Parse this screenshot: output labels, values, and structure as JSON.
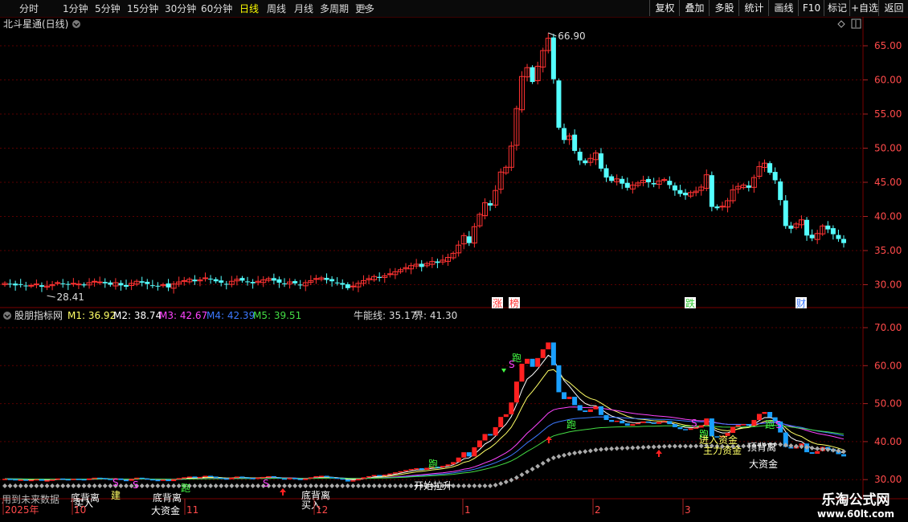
{
  "periods": [
    {
      "label": "分时",
      "active": false
    },
    {
      "label": "1分钟",
      "active": false
    },
    {
      "label": "5分钟",
      "active": false
    },
    {
      "label": "15分钟",
      "active": false
    },
    {
      "label": "30分钟",
      "active": false
    },
    {
      "label": "60分钟",
      "active": false
    },
    {
      "label": "日线",
      "active": true
    },
    {
      "label": "周线",
      "active": false
    },
    {
      "label": "月线",
      "active": false
    },
    {
      "label": "多周期",
      "active": false
    },
    {
      "label": "更多",
      "active": false
    }
  ],
  "right_buttons": [
    "复权",
    "叠加",
    "多股",
    "统计",
    "画线",
    "F10",
    "标记",
    "+自选",
    "返回"
  ],
  "main_title": "北斗星通(日线)",
  "price_axis": [
    "65.00",
    "60.00",
    "55.00",
    "50.00",
    "45.00",
    "40.00",
    "35.00",
    "30.00"
  ],
  "price_high_label": "66.90",
  "price_low_label": "28.41",
  "event_badges": [
    "涨",
    "榜",
    "跌",
    "财"
  ],
  "indicator": {
    "name": "股朋指标网",
    "M1": "M1: 36.92",
    "M2": "M2: 38.74",
    "M3": "M3: 42.67",
    "M4": "M4: 42.39",
    "M5": "M5: 39.51",
    "bull": "牛能线: 35.17",
    "bound": "界: 41.30",
    "axis": [
      "70.00",
      "60.00",
      "50.00",
      "40.00",
      "30.00"
    ]
  },
  "signals": {
    "pao": "跑",
    "s": "S",
    "dazijin": "大资金",
    "jiaruzijin": "进入资金",
    "jin_label": "建",
    "buyin": "买入",
    "beili": "底背离",
    "ding_beili": "顶背离",
    "zhudazijin": "主力资金",
    "kaishi": "开始拉升"
  },
  "future_note": "用到未来数据",
  "time_axis": [
    "2025年",
    "10",
    "11",
    "12",
    "1",
    "2",
    "3"
  ],
  "watermark": {
    "title": "乐淘公式网",
    "url": "www.60lt.com"
  },
  "colors": {
    "up": "#ff3232",
    "down": "#54ffff",
    "M1": "#ffffff",
    "M2": "#ffff00",
    "M3": "#ff00ff",
    "M4": "#3c78ff",
    "M5": "#32c832"
  },
  "chart_data": {
    "type": "candlestick",
    "title": "北斗星通(日线)",
    "period": "daily",
    "x": [
      "2025-09",
      "2025-10",
      "2025-11",
      "2025-12",
      "2026-01",
      "2026-02",
      "2026-03"
    ],
    "ylim": [
      27,
      68
    ],
    "high": 66.9,
    "low": 28.41,
    "closes": [
      30.2,
      30.1,
      29.9,
      30.0,
      29.8,
      29.9,
      30.1,
      29.7,
      29.8,
      30.0,
      30.3,
      30.1,
      30.0,
      30.2,
      30.1,
      29.9,
      30.3,
      30.5,
      30.4,
      30.2,
      30.0,
      30.3,
      29.9,
      29.7,
      30.2,
      30.5,
      30.3,
      30.1,
      29.9,
      29.8,
      30.0,
      29.6,
      30.1,
      30.4,
      30.6,
      30.8,
      30.5,
      30.7,
      31.0,
      30.8,
      30.5,
      30.3,
      30.1,
      30.5,
      30.8,
      30.6,
      30.4,
      30.2,
      30.5,
      30.7,
      30.9,
      30.6,
      30.3,
      30.1,
      30.4,
      30.2,
      29.9,
      30.3,
      30.6,
      30.9,
      31.0,
      30.7,
      30.5,
      30.3,
      30.0,
      29.5,
      29.8,
      30.2,
      30.6,
      30.9,
      31.2,
      31.0,
      31.3,
      31.6,
      31.9,
      32.2,
      32.5,
      32.8,
      33.0,
      32.6,
      33.1,
      33.4,
      33.2,
      33.6,
      34.0,
      34.6,
      35.8,
      37.2,
      36.1,
      38.5,
      40.3,
      42.0,
      41.6,
      43.8,
      46.5,
      47.2,
      50.3,
      55.8,
      60.5,
      61.8,
      59.7,
      62.0,
      64.3,
      66.1,
      60.1,
      53.0,
      51.2,
      51.8,
      49.6,
      48.2,
      47.8,
      48.5,
      49.3,
      47.0,
      45.7,
      45.2,
      45.5,
      44.8,
      44.2,
      44.6,
      44.9,
      45.3,
      45.0,
      44.7,
      45.2,
      45.4,
      44.6,
      43.8,
      43.3,
      43.1,
      43.5,
      43.7,
      44.3,
      46.1,
      41.4,
      41.2,
      41.5,
      42.3,
      43.9,
      44.4,
      44.6,
      44.2,
      45.7,
      47.3,
      47.8,
      46.4,
      45.3,
      42.4,
      38.6,
      38.2,
      38.9,
      39.5,
      37.2,
      36.8,
      37.5,
      38.6,
      38.1,
      37.4,
      36.7,
      36.1
    ]
  }
}
